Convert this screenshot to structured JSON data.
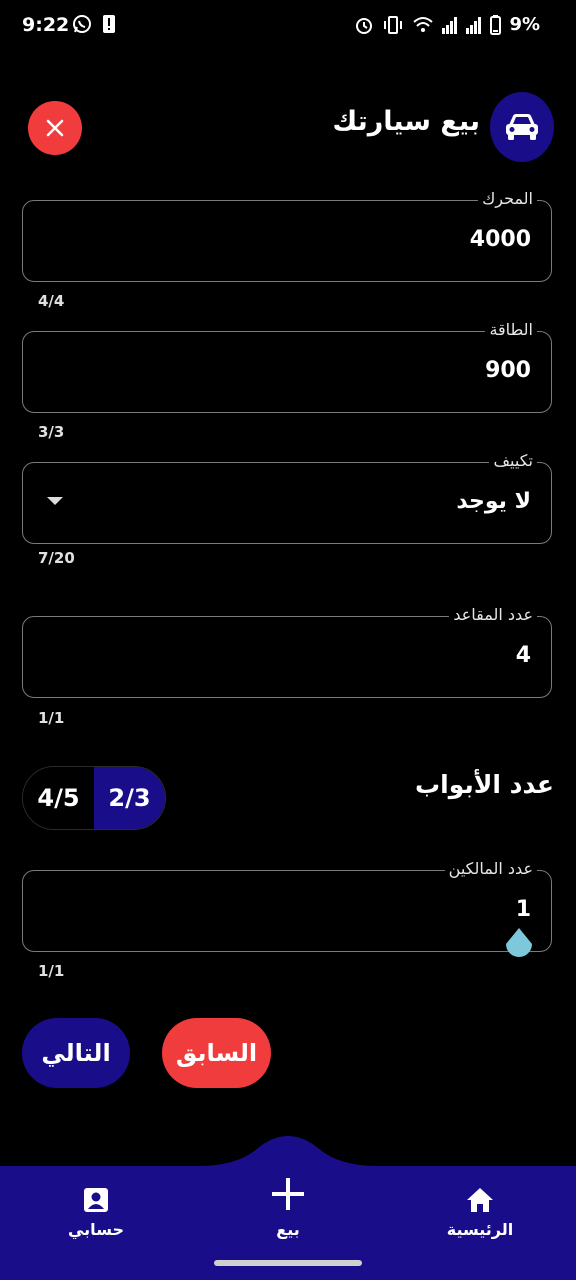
{
  "status_bar": {
    "time": "9:22",
    "battery_percent": "9%",
    "icons": [
      "whatsapp-icon",
      "notification-icon",
      "alarm-icon",
      "vibrate-icon",
      "wifi-icon",
      "signal-icon",
      "signal-icon",
      "battery-icon"
    ]
  },
  "header": {
    "title": "بيع سيارتك",
    "avatar_icon": "car-icon",
    "close_icon": "close-icon"
  },
  "form": {
    "engine": {
      "label": "المحرك",
      "value": "4000",
      "counter": "4/4"
    },
    "power": {
      "label": "الطاقة",
      "value": "900",
      "counter": "3/3"
    },
    "ac": {
      "label": "تكييف",
      "value": "لا يوجد",
      "counter": "7/20"
    },
    "seats": {
      "label": "عدد المقاعد",
      "value": "4",
      "counter": "1/1"
    },
    "doors": {
      "label": "عدد الأبواب",
      "options": [
        "2/3",
        "4/5"
      ],
      "selected": "2/3"
    },
    "owners": {
      "label": "عدد المالكين",
      "value": "1",
      "counter": "1/1"
    }
  },
  "actions": {
    "next_label": "التالي",
    "previous_label": "السابق"
  },
  "bottom_nav": {
    "items": [
      {
        "label": "حسابي",
        "icon": "account-icon"
      },
      {
        "label": "بيع",
        "icon": "add-icon"
      },
      {
        "label": "الرئيسية",
        "icon": "home-icon"
      }
    ]
  },
  "colors": {
    "primary": "#1a0d8a",
    "danger": "#f03c3c",
    "background": "#000000",
    "cursor": "#7ec8dc"
  }
}
